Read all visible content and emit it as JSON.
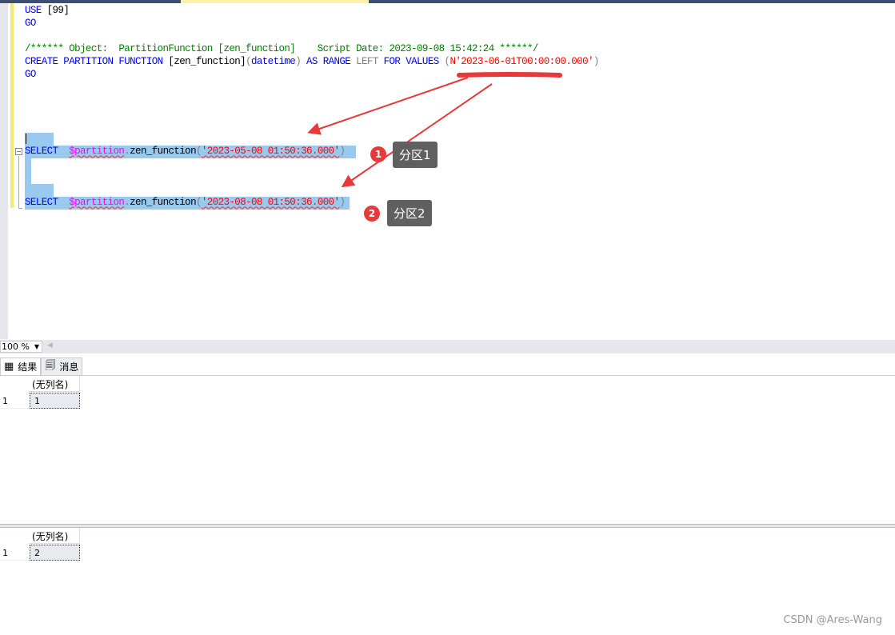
{
  "editor": {
    "lines": {
      "use": {
        "kw": "USE",
        "rest": " [99]"
      },
      "go1": "GO",
      "comment": "/****** Object:  PartitionFunction [zen_function]    Script Date: 2023-09-08 15:42:24 ******/",
      "create": {
        "a": "CREATE PARTITION FUNCTION",
        "b": " [zen_function]",
        "c": "(",
        "d": "datetime",
        "e": ")",
        "f": " AS RANGE ",
        "g": "LEFT",
        "h": " FOR VALUES ",
        "i": "(",
        "j": "N'2023-06-01T00:00:00.000'",
        "k": ")"
      },
      "go2": "GO",
      "select1": {
        "kw": "SELECT",
        "fn": "$partition",
        "dot": ".",
        "name": "zen_function",
        "p1": "(",
        "str": "'2023-05-08 01:50:36.000'",
        "p2": ")"
      },
      "select2": {
        "kw": "SELECT",
        "fn": "$partition",
        "dot": ".",
        "name": "zen_function",
        "p1": "(",
        "str": "'2023-08-08 01:50:36.000'",
        "p2": ")"
      }
    }
  },
  "zoom": "100 %",
  "results": {
    "tabs": [
      {
        "label": "结果",
        "icon": "grid-icon"
      },
      {
        "label": "消息",
        "icon": "messages-icon"
      }
    ],
    "grids": [
      {
        "header": "(无列名)",
        "rows": [
          {
            "num": "1",
            "value": "1"
          }
        ]
      },
      {
        "header": "(无列名)",
        "rows": [
          {
            "num": "1",
            "value": "2"
          }
        ]
      }
    ]
  },
  "annotations": [
    {
      "badge": "1",
      "label": "分区1"
    },
    {
      "badge": "2",
      "label": "分区2"
    }
  ],
  "annotation_color": "#e8393a",
  "watermark": "CSDN @Ares-Wang"
}
